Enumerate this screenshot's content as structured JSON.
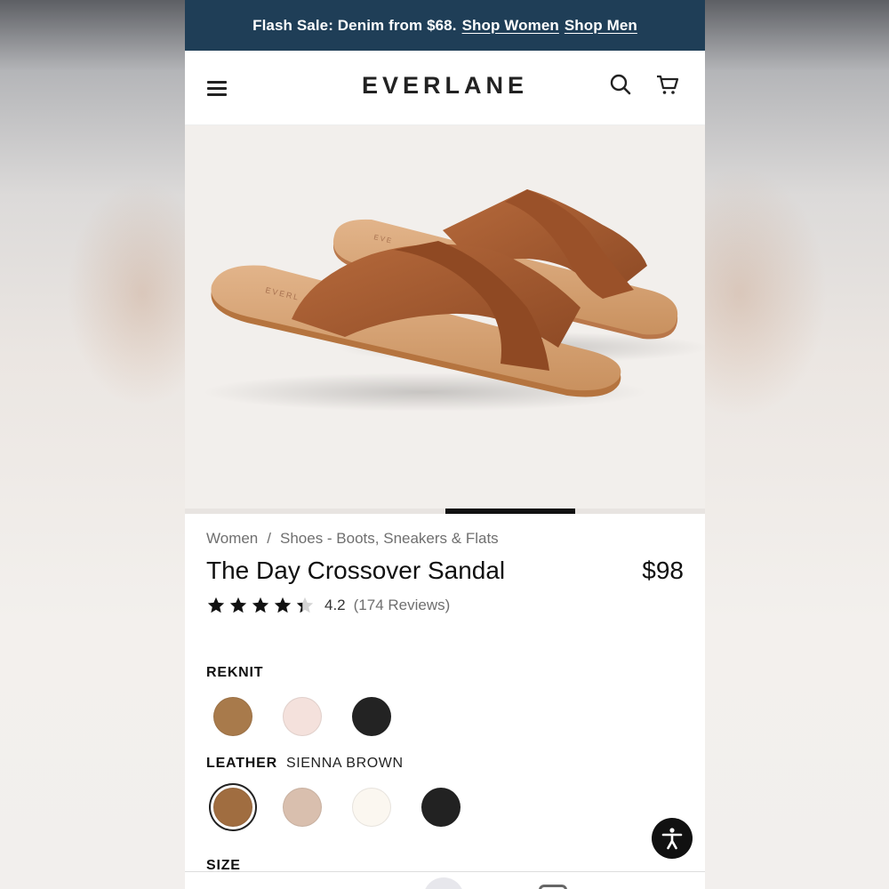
{
  "promo": {
    "text": "Flash Sale: Denim from $68.",
    "link_women": "Shop Women",
    "link_men": "Shop Men",
    "bg_color": "#1f3e57"
  },
  "header": {
    "logo": "EVERLANE",
    "icons": [
      "menu-icon",
      "search-icon",
      "cart-icon"
    ]
  },
  "hero": {
    "image": "sandal-product-photo",
    "bg_color": "#f2efec",
    "sandal_color": "#a85e35",
    "footbed_color": "#d9a577"
  },
  "breadcrumb": {
    "items": [
      "Women",
      "Shoes - Boots, Sneakers & Flats"
    ],
    "separator": "/"
  },
  "product": {
    "title": "The Day Crossover Sandal",
    "price": "$98",
    "rating": "4.2",
    "reviews": "(174 Reviews)",
    "rating_value": 4.2
  },
  "reknit": {
    "label": "REKNIT",
    "swatches": [
      "#a87a4b",
      "#f4e1dc",
      "#232323"
    ]
  },
  "leather": {
    "label": "LEATHER",
    "selected": "SIENNA BROWN",
    "swatches": [
      "#a06d40",
      "#d9bfae",
      "#fbf7f0",
      "#222222"
    ]
  },
  "size": {
    "label": "SIZE"
  }
}
